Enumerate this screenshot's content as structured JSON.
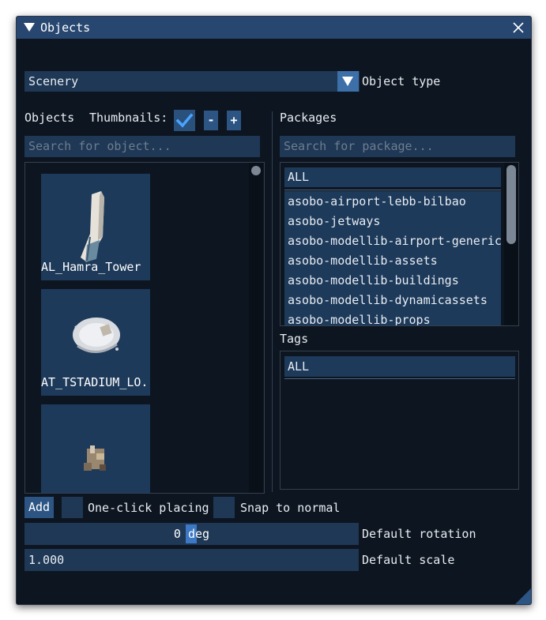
{
  "window": {
    "title": "Objects"
  },
  "object_type": {
    "selected": "Scenery",
    "label": "Object type"
  },
  "objects_header": {
    "label": "Objects",
    "thumbnails_label": "Thumbnails:",
    "thumbnails_checked": true,
    "minus_label": "-",
    "plus_label": "+"
  },
  "object_search": {
    "placeholder": "Search for object..."
  },
  "objects": [
    {
      "label": "AL_Hamra_Tower",
      "icon": "tower-model-icon"
    },
    {
      "label": "AT_TSTADIUM_LO...",
      "icon": "stadium-model-icon"
    },
    {
      "label": "",
      "icon": "structure-model-icon"
    }
  ],
  "packages": {
    "label": "Packages",
    "search_placeholder": "Search for package...",
    "items": [
      "ALL",
      "asobo-airport-lebb-bilbao",
      "asobo-jetways",
      "asobo-modellib-airport-generic",
      "asobo-modellib-assets",
      "asobo-modellib-buildings",
      "asobo-modellib-dynamicassets",
      "asobo-modellib-props"
    ]
  },
  "tags": {
    "label": "Tags",
    "items": [
      "ALL"
    ]
  },
  "bottom": {
    "add_label": "Add",
    "one_click_label": "One-click placing",
    "one_click_checked": false,
    "snap_label": "Snap to normal",
    "snap_checked": false,
    "rotation_value": "0 deg",
    "rotation_label": "Default rotation",
    "scale_value": "1.000",
    "scale_label": "Default scale"
  },
  "colors": {
    "title_bar": "#274770",
    "window_bg": "#0d1520",
    "field_bg": "#1e3855",
    "accent": "#3d78c4"
  }
}
